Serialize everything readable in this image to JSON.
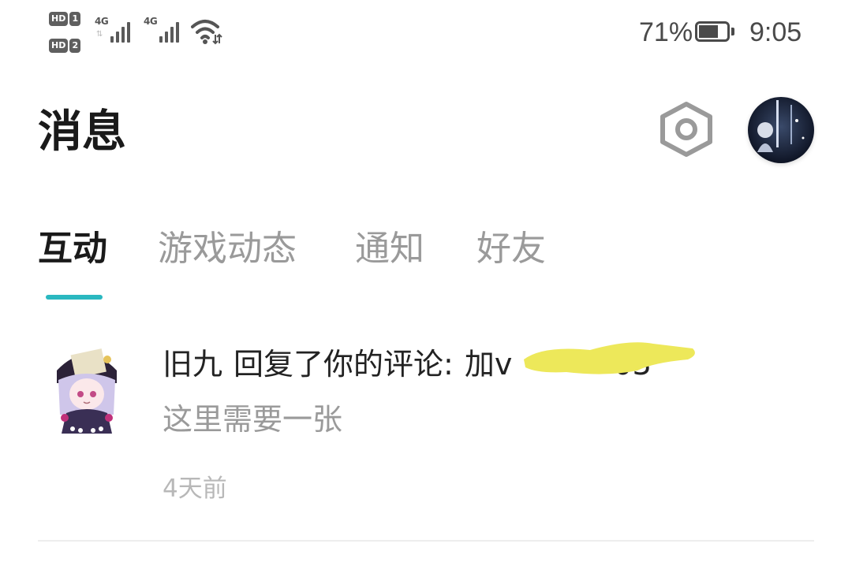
{
  "status_bar": {
    "sim1_hd": "HD",
    "sim1_num": "1",
    "sim2_hd": "HD",
    "sim2_num": "2",
    "sim1_network": "4G",
    "sim2_network": "4G",
    "battery_percent": "71%",
    "battery_level": 0.71,
    "time": "9:05"
  },
  "header": {
    "title": "消息",
    "settings_icon": "hexagon-settings-icon",
    "profile_avatar": "profile-avatar"
  },
  "tabs": {
    "items": [
      {
        "label": "互动",
        "active": true
      },
      {
        "label": "游戏动态",
        "active": false
      },
      {
        "label": "通知",
        "active": false
      },
      {
        "label": "好友",
        "active": false
      }
    ]
  },
  "messages": [
    {
      "sender": "旧九",
      "action": "回复了你的评论:",
      "preview_visible": "加v",
      "preview_tail": "03",
      "sub_text": "这里需要一张",
      "time": "4天前"
    }
  ],
  "colors": {
    "accent": "#2ab8c0",
    "title_text": "#1a1a1a",
    "inactive_tab": "#9a9a9a",
    "secondary_text": "#9a9a9a",
    "time_text": "#b8b8b8",
    "redaction": "#ede85a",
    "divider": "#eeeeee"
  }
}
